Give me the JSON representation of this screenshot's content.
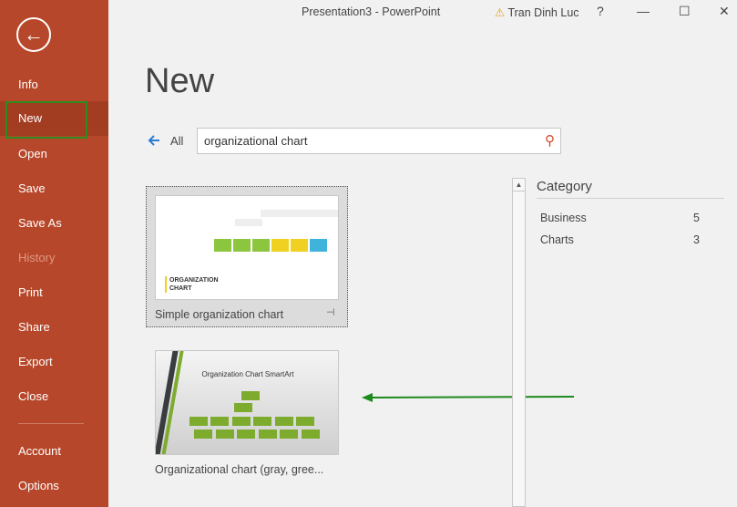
{
  "window": {
    "title": "Presentation3  -  PowerPoint",
    "user": "Tran Dinh Luc",
    "help": "?",
    "minimize": "—",
    "maximize": "☐",
    "close": "✕"
  },
  "sidebar": {
    "items": [
      {
        "label": "Info"
      },
      {
        "label": "New"
      },
      {
        "label": "Open"
      },
      {
        "label": "Save"
      },
      {
        "label": "Save As"
      },
      {
        "label": "History"
      },
      {
        "label": "Print"
      },
      {
        "label": "Share"
      },
      {
        "label": "Export"
      },
      {
        "label": "Close"
      },
      {
        "label": "Account"
      },
      {
        "label": "Options"
      }
    ]
  },
  "main": {
    "heading": "New",
    "all_link": "All",
    "search_value": "organizational chart",
    "templates": [
      {
        "name": "Simple organization chart",
        "thumb_title": "ORGANIZATION CHART"
      },
      {
        "name": "Organizational chart (gray, gree...",
        "thumb_title": "Organization Chart SmartArt"
      }
    ]
  },
  "category": {
    "heading": "Category",
    "items": [
      {
        "label": "Business",
        "count": "5"
      },
      {
        "label": "Charts",
        "count": "3"
      }
    ]
  },
  "colors": {
    "sidebar": "#b7472a",
    "accent_green": "#1e8a1e"
  }
}
